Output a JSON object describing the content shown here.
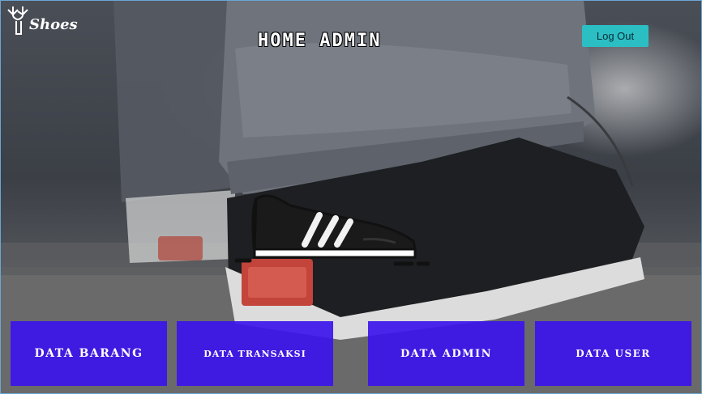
{
  "header": {
    "logo_text": "Shoes",
    "title": "Home Admin",
    "logout_label": "Log Out"
  },
  "menu": [
    {
      "label": "Data Barang"
    },
    {
      "label": "Data Transaksi"
    },
    {
      "label": "Data Admin"
    },
    {
      "label": "Data User"
    }
  ],
  "colors": {
    "accent": "#2bbfc4",
    "card": "#3c14eb"
  },
  "icons": {
    "logo": "deer-antler-logo",
    "center": "sneaker-icon"
  }
}
